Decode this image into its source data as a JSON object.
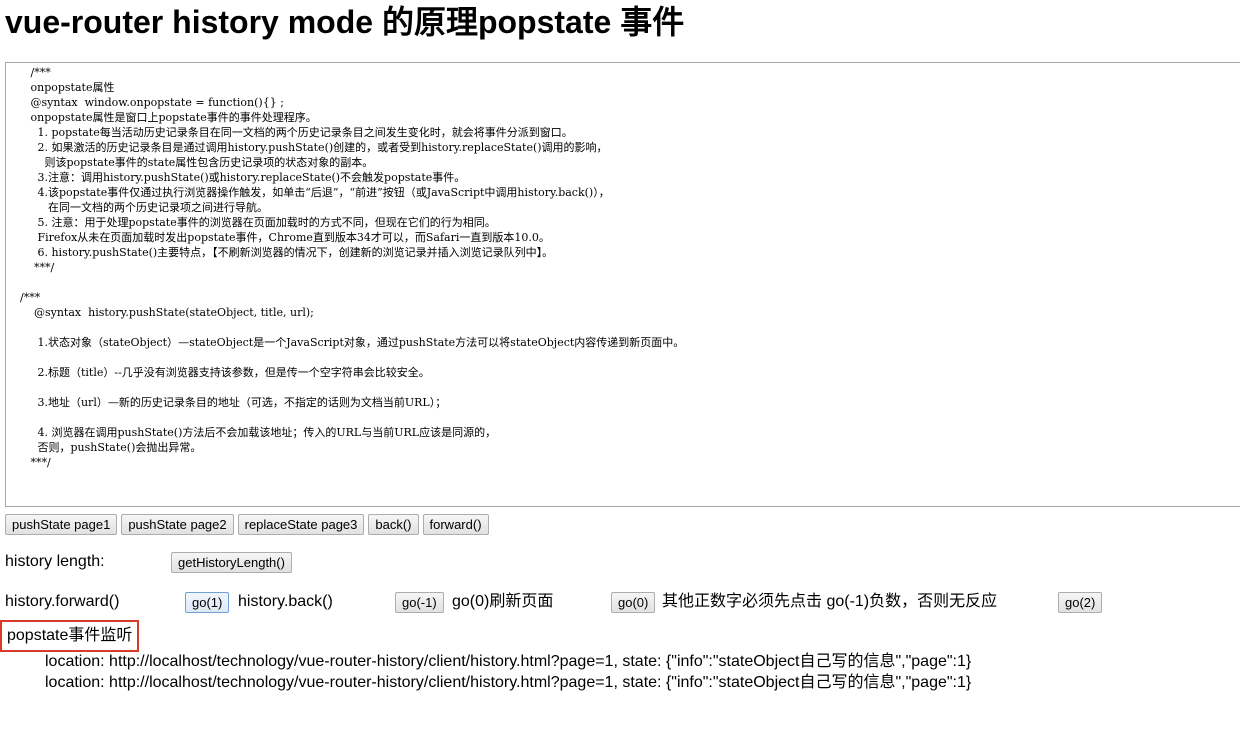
{
  "page": {
    "title": "vue-router history mode 的原理popstate 事件"
  },
  "code_block": {
    "lines": [
      "   /***",
      "   onpopstate属性",
      "   @syntax  window.onpopstate = function(){} ;",
      "   onpopstate属性是窗口上popstate事件的事件处理程序。",
      "     1. popstate每当活动历史记录条目在同一文档的两个历史记录条目之间发生变化时，就会将事件分派到窗口。",
      "     2. 如果激活的历史记录条目是通过调用history.pushState()创建的，或者受到history.replaceState()调用的影响，",
      "       则该popstate事件的state属性包含历史记录项的状态对象的副本。",
      "     3.注意：调用history.pushState()或history.replaceState()不会触发popstate事件。",
      "     4.该popstate事件仅通过执行浏览器操作触发，如单击“后退”，“前进”按钮（或JavaScript中调用history.back()），",
      "        在同一文档的两个历史记录项之间进行导航。",
      "     5. 注意：用于处理popstate事件的浏览器在页面加载时的方式不同，但现在它们的行为相同。",
      "     Firefox从未在页面加载时发出popstate事件，Chrome直到版本34才可以，而Safari一直到版本10.0。",
      "     6. history.pushState()主要特点，【不刷新浏览器的情况下，创建新的浏览记录并插入浏览记录队列中】。",
      "    ***/",
      "",
      "/***",
      "    @syntax  history.pushState(stateObject, title, url);",
      "",
      "     1.状态对象（stateObject）—stateObject是一个JavaScript对象，通过pushState方法可以将stateObject内容传递到新页面中。",
      "",
      "     2.标题（title）--几乎没有浏览器支持该参数，但是传一个空字符串会比较安全。",
      "",
      "     3.地址（url）—新的历史记录条目的地址（可选，不指定的话则为文档当前URL）；",
      "",
      "     4. 浏览器在调用pushState()方法后不会加载该地址；传入的URL与当前URL应该是同源的，",
      "     否则，pushState()会抛出异常。",
      "   ***/"
    ]
  },
  "toolbar": {
    "push_page1": "pushState page1",
    "push_page2": "pushState page2",
    "replace_page3": "replaceState page3",
    "back": "back()",
    "forward": "forward()"
  },
  "length_row": {
    "label": "history length:",
    "button": "getHistoryLength()"
  },
  "go_row": {
    "forward_label": "history.forward()",
    "go1": "go(1)",
    "back_label": "history.back()",
    "go_minus1": "go(-1)",
    "go0_label": "go(0)刷新页面",
    "go0": "go(0)",
    "note": "其他正数字必须先点击 go(-1)负数，否则无反应",
    "go2": "go(2)"
  },
  "popstate": {
    "label": "popstate事件监听",
    "log": [
      "location: http://localhost/technology/vue-router-history/client/history.html?page=1, state: {\"info\":\"stateObject自己写的信息\",\"page\":1}",
      "location: http://localhost/technology/vue-router-history/client/history.html?page=1, state: {\"info\":\"stateObject自己写的信息\",\"page\":1}"
    ]
  },
  "colors": {
    "highlight_border": "#d93b2b",
    "focused_button_border": "#6e9fd6"
  }
}
